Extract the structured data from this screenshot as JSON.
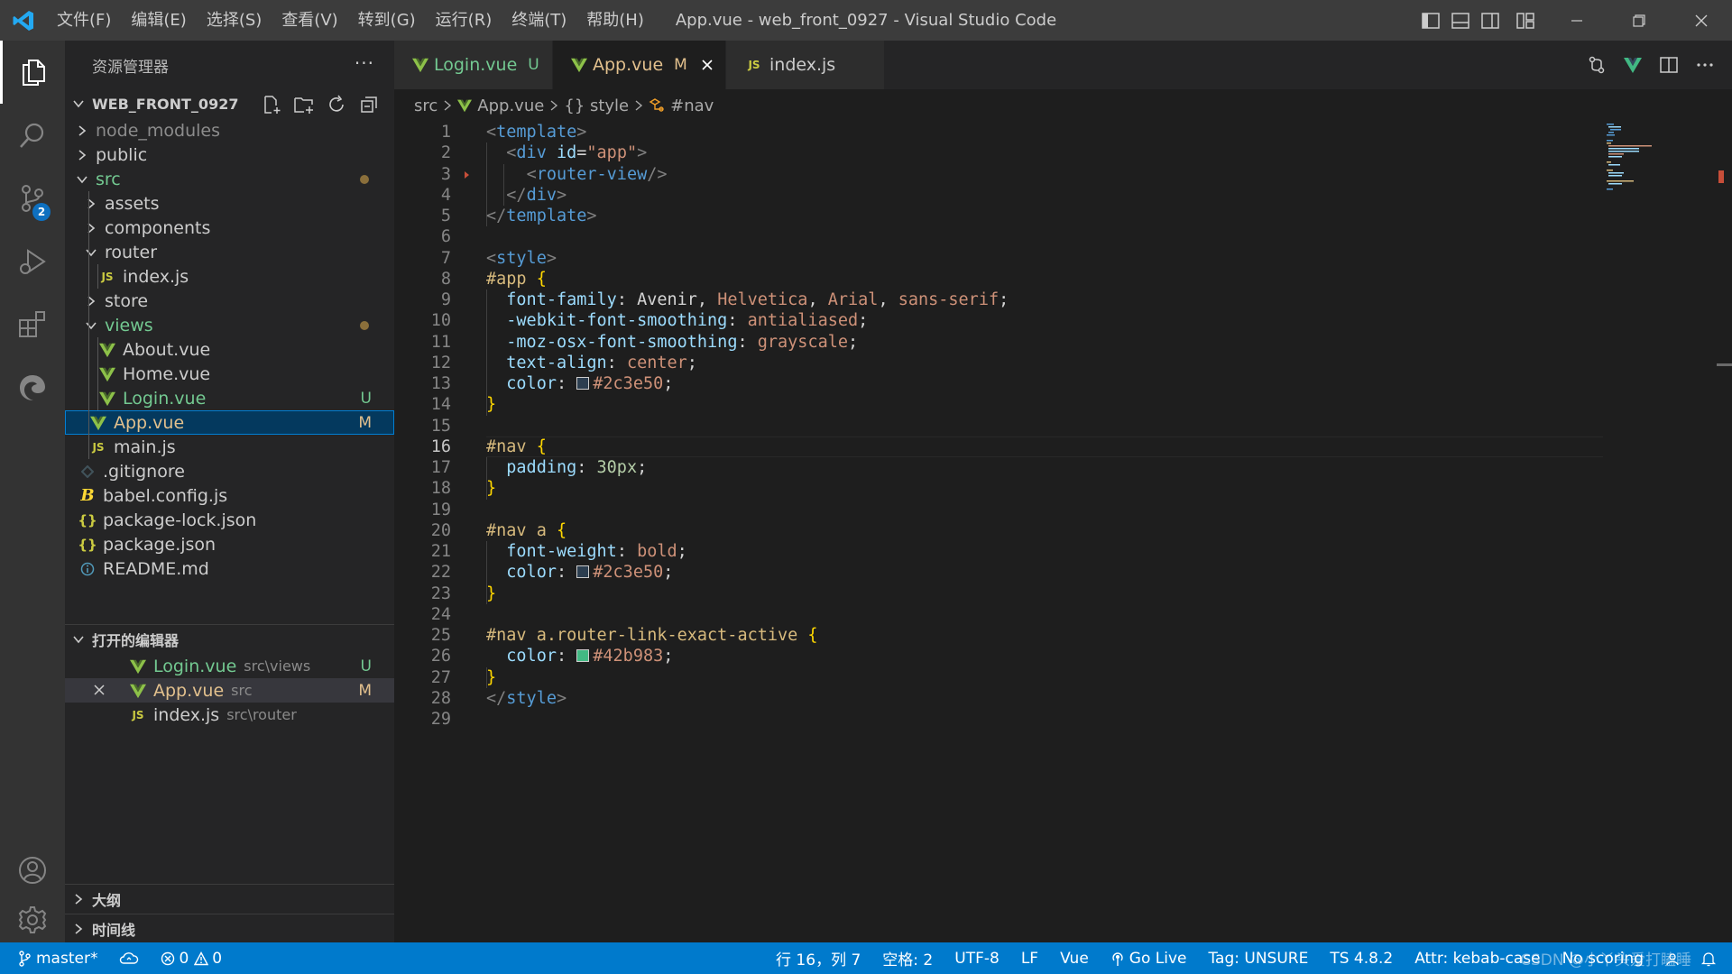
{
  "titlebar": {
    "menus": [
      "文件(F)",
      "编辑(E)",
      "选择(S)",
      "查看(V)",
      "转到(G)",
      "运行(R)",
      "终端(T)",
      "帮助(H)"
    ],
    "title": "App.vue - web_front_0927 - Visual Studio Code"
  },
  "activity": {
    "scm_badge": "2"
  },
  "explorer": {
    "header": "资源管理器",
    "more": "···",
    "root": "WEB_FRONT_0927",
    "items": [
      {
        "label": "node_modules",
        "color": "#8c8c8c"
      },
      {
        "label": "public",
        "color": "#cccccc"
      },
      {
        "label": "src",
        "color": "#73c991"
      },
      {
        "label": "assets",
        "color": "#cccccc"
      },
      {
        "label": "components",
        "color": "#cccccc"
      },
      {
        "label": "router",
        "color": "#cccccc"
      },
      {
        "label": "index.js",
        "color": "#cccccc"
      },
      {
        "label": "store",
        "color": "#cccccc"
      },
      {
        "label": "views",
        "color": "#73c991"
      },
      {
        "label": "About.vue",
        "color": "#cccccc"
      },
      {
        "label": "Home.vue",
        "color": "#cccccc"
      },
      {
        "label": "Login.vue",
        "color": "#73c991",
        "status": "U"
      },
      {
        "label": "App.vue",
        "color": "#e2c08d",
        "status": "M"
      },
      {
        "label": "main.js",
        "color": "#cccccc"
      },
      {
        "label": ".gitignore",
        "color": "#cccccc"
      },
      {
        "label": "babel.config.js",
        "color": "#cccccc"
      },
      {
        "label": "package-lock.json",
        "color": "#cccccc"
      },
      {
        "label": "package.json",
        "color": "#cccccc"
      },
      {
        "label": "README.md",
        "color": "#cccccc"
      }
    ]
  },
  "open_editors": {
    "header": "打开的编辑器",
    "items": [
      {
        "label": "Login.vue",
        "desc": "src\\views",
        "status": "U"
      },
      {
        "label": "App.vue",
        "desc": "src",
        "status": "M"
      },
      {
        "label": "index.js",
        "desc": "src\\router",
        "status": ""
      }
    ]
  },
  "outline": {
    "header": "大纲"
  },
  "timeline": {
    "header": "时间线"
  },
  "tabs": [
    {
      "label": "Login.vue",
      "mark": "U",
      "color": "#73c991"
    },
    {
      "label": "App.vue",
      "mark": "M",
      "color": "#e2c08d"
    },
    {
      "label": "index.js",
      "mark": "",
      "color": "#cccccc"
    }
  ],
  "breadcrumb": [
    "src",
    "App.vue",
    "{} style",
    "#nav"
  ],
  "editor": {
    "current_line": 16,
    "lines": [
      "<template>",
      "  <div id=\"app\">",
      "    <router-view/>",
      "  </div>",
      "</template>",
      "",
      "<style>",
      "#app {",
      "  font-family: Avenir, Helvetica, Arial, sans-serif;",
      "  -webkit-font-smoothing: antialiased;",
      "  -moz-osx-font-smoothing: grayscale;",
      "  text-align: center;",
      "  color: #2c3e50;",
      "}",
      "",
      "#nav {",
      "  padding: 30px;",
      "}",
      "",
      "#nav a {",
      "  font-weight: bold;",
      "  color: #2c3e50;",
      "}",
      "",
      "#nav a.router-link-exact-active {",
      "  color: #42b983;",
      "}",
      "</style>",
      ""
    ]
  },
  "statusbar": {
    "branch": "master*",
    "errors": "0",
    "warnings": "0",
    "position": "行 16，列 7",
    "spaces": "空格: 2",
    "encoding": "UTF-8",
    "eol": "LF",
    "language": "Vue",
    "golive": "Go Live",
    "tag": "Tag: UNSURE",
    "ts": "TS 4.8.2",
    "attr": "Attr: kebab-case",
    "scoring": "No scoring",
    "watermark": "CSDN @小丫头爱打瞌睡"
  }
}
